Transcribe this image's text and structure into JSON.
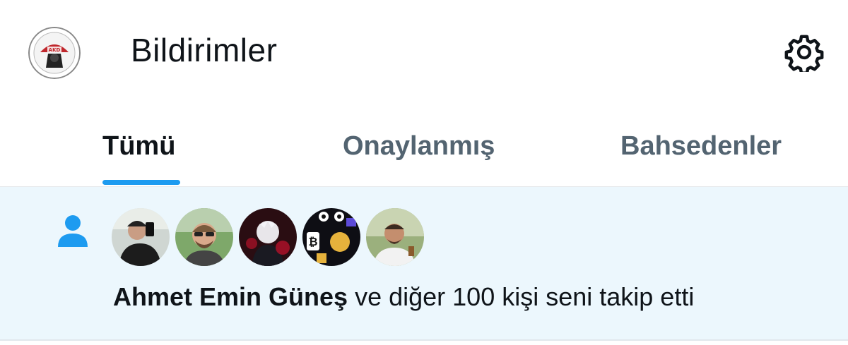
{
  "header": {
    "title": "Bildirimler",
    "profile_icon": "org-logo-avatar",
    "settings_icon": "gear-icon"
  },
  "tabs": [
    {
      "label": "Tümü",
      "active": true
    },
    {
      "label": "Onaylanmış",
      "active": false
    },
    {
      "label": "Bahsedenler",
      "active": false
    }
  ],
  "notification": {
    "type_icon": "person-icon",
    "actor_name": "Ahmet Emin Güneş",
    "message": "ve diğer 100 kişi seni takip etti",
    "avatar_count": 5
  },
  "colors": {
    "accent": "#1d9bf0",
    "highlight_bg": "#ecf7fd",
    "muted_text": "#536471",
    "primary_text": "#0f1419"
  }
}
